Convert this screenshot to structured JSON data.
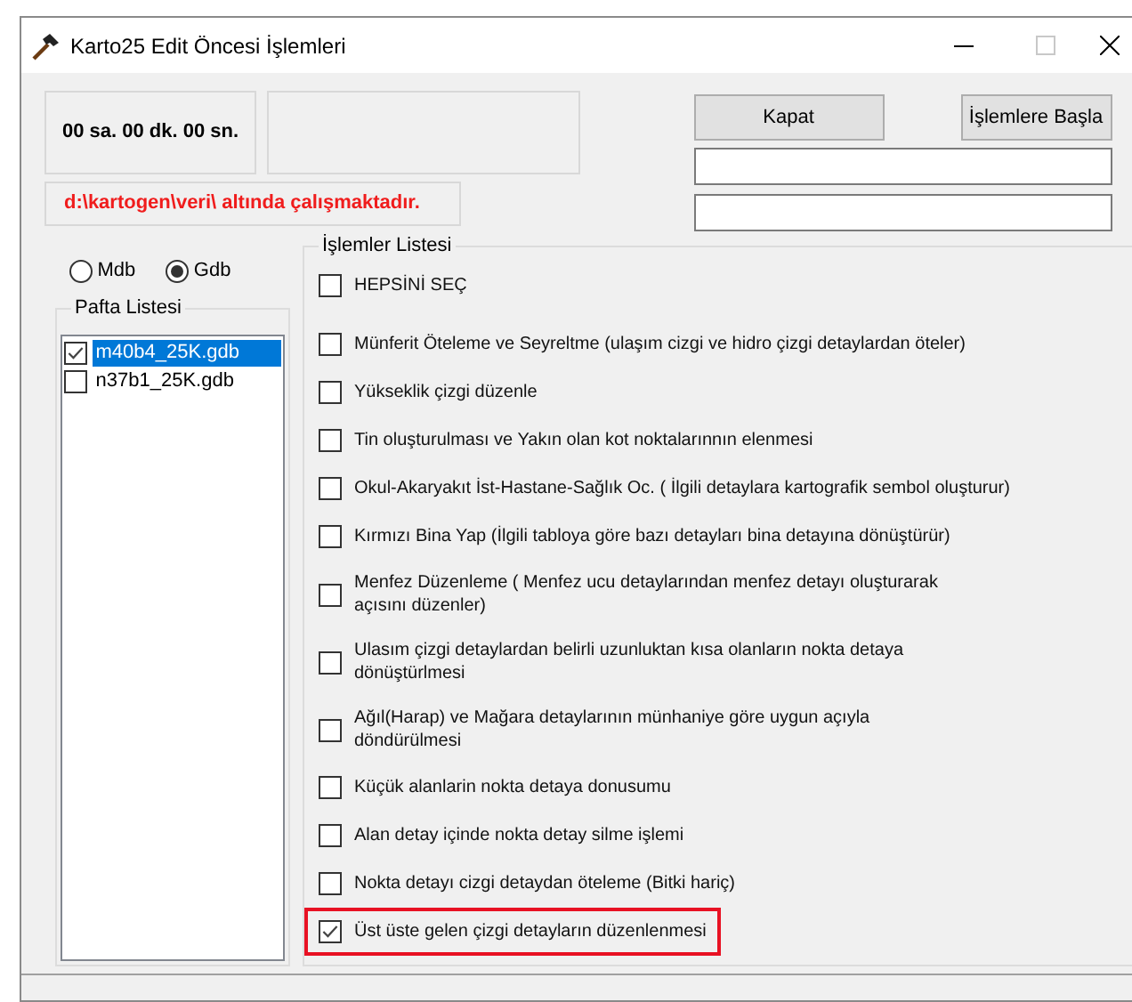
{
  "window": {
    "title": "Karto25 Edit Öncesi İşlemleri"
  },
  "timer": "00 sa. 00 dk. 00 sn.",
  "status_message": "d:\\kartogen\\veri\\ altında çalışmaktadır.",
  "buttons": [
    {
      "label": "Kapat"
    },
    {
      "label": "İşlemlere Başla"
    }
  ],
  "source_options": [
    {
      "label": "Mdb",
      "selected": false
    },
    {
      "label": "Gdb",
      "selected": true
    }
  ],
  "sheet_list": {
    "title": "Pafta Listesi",
    "items": [
      {
        "label": "m40b4_25K.gdb",
        "checked": true,
        "selected": true
      },
      {
        "label": "n37b1_25K.gdb",
        "checked": false,
        "selected": false
      }
    ]
  },
  "operations": {
    "title": "İşlemler Listesi",
    "select_all": {
      "label": "HEPSİNİ SEÇ",
      "checked": false
    },
    "items": [
      {
        "label": "Münferit Öteleme ve Seyreltme (ulaşım cizgi ve hidro çizgi detaylardan öteler)",
        "checked": false,
        "highlighted": false
      },
      {
        "label": "Yükseklik çizgi düzenle",
        "checked": false,
        "highlighted": false
      },
      {
        "label": "Tin oluşturulması ve Yakın olan kot noktalarınnın elenmesi",
        "checked": false,
        "highlighted": false
      },
      {
        "label": "Okul-Akaryakıt İst-Hastane-Sağlık Oc. ( İlgili detaylara kartografik sembol oluşturur)",
        "checked": false,
        "highlighted": false
      },
      {
        "label": "Kırmızı Bina Yap (İlgili tabloya göre bazı detayları bina detayına dönüştürür)",
        "checked": false,
        "highlighted": false
      },
      {
        "label": "Menfez Düzenleme ( Menfez ucu detaylarından menfez detayı oluşturarak\naçısını düzenler)",
        "checked": false,
        "highlighted": false
      },
      {
        "label": "Ulasım çizgi detaylardan belirli uzunluktan kısa olanların nokta detaya\ndönüştürlmesi",
        "checked": false,
        "highlighted": false
      },
      {
        "label": "Ağıl(Harap) ve Mağara detaylarının münhaniye göre uygun açıyla\ndöndürülmesi",
        "checked": false,
        "highlighted": false
      },
      {
        "label": "Küçük alanlarin nokta detaya donusumu",
        "checked": false,
        "highlighted": false
      },
      {
        "label": "Alan detay içinde nokta detay silme işlemi",
        "checked": false,
        "highlighted": false
      },
      {
        "label": "Nokta  detayı cizgi detaydan öteleme (Bitki hariç)",
        "checked": false,
        "highlighted": false
      },
      {
        "label": "Üst üste gelen çizgi detayların düzenlenmesi",
        "checked": true,
        "highlighted": true
      }
    ]
  }
}
